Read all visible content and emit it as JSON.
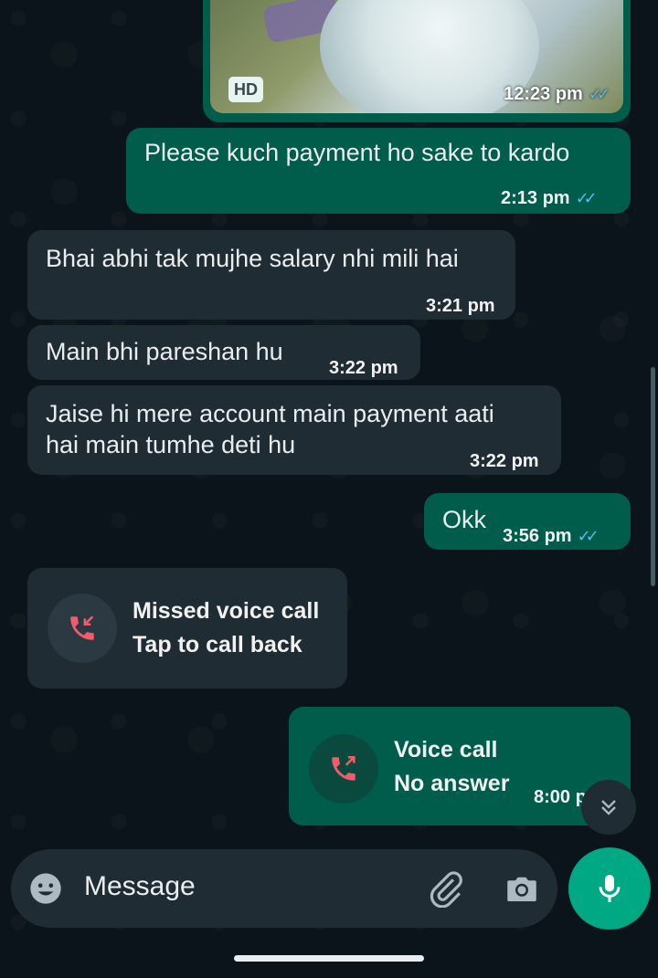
{
  "image_message": {
    "badge": "HD",
    "time": "12:23 pm",
    "status": "read"
  },
  "messages": [
    {
      "direction": "out",
      "text": "Please kuch payment ho sake to kardo",
      "time": "2:13 pm",
      "status": "read"
    },
    {
      "direction": "in",
      "text": "Bhai abhi tak mujhe salary nhi mili hai",
      "time": "3:21 pm"
    },
    {
      "direction": "in",
      "text": "Main bhi pareshan hu",
      "time": "3:22 pm"
    },
    {
      "direction": "in",
      "text_line1": "Jaise hi mere account main payment aati",
      "text_line2": "hai main tumhe deti hu",
      "time": "3:22 pm"
    },
    {
      "direction": "out",
      "text": "Okk",
      "time": "3:56 pm",
      "status": "read"
    }
  ],
  "missed_call": {
    "title": "Missed voice call",
    "subtitle": "Tap to call back",
    "icon": "missed-call-icon"
  },
  "voice_call": {
    "title": "Voice call",
    "subtitle": "No answer",
    "time": "8:00 p",
    "icon": "outgoing-call-icon"
  },
  "composer": {
    "placeholder": "Message",
    "icons": [
      "emoji-icon",
      "attach-icon",
      "camera-icon",
      "mic-icon"
    ]
  },
  "colors": {
    "background": "#0b141a",
    "incoming_bubble": "#202c33",
    "outgoing_bubble": "#005c4b",
    "accent": "#00a884",
    "read_ticks": "#53bdeb",
    "call_icon": "#f15c6d"
  }
}
